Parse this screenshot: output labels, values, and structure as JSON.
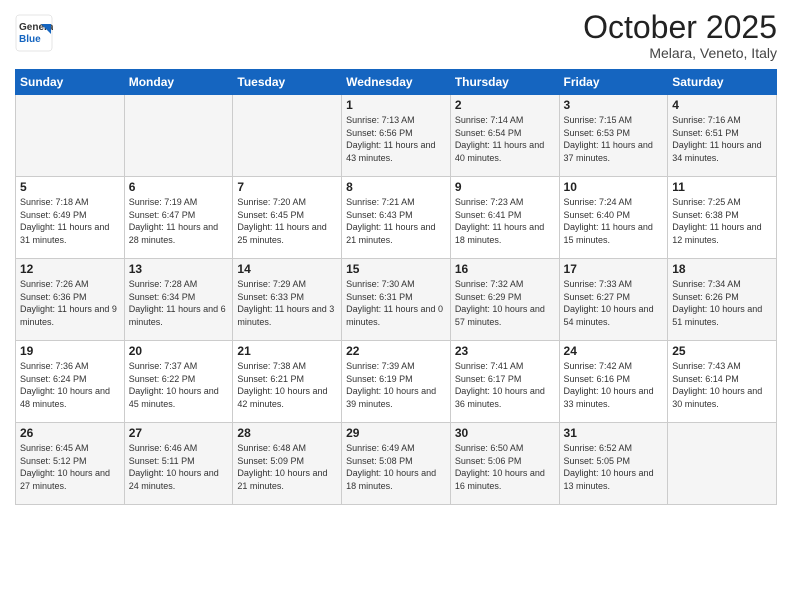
{
  "logo": {
    "general": "General",
    "blue": "Blue"
  },
  "header": {
    "month": "October 2025",
    "location": "Melara, Veneto, Italy"
  },
  "weekdays": [
    "Sunday",
    "Monday",
    "Tuesday",
    "Wednesday",
    "Thursday",
    "Friday",
    "Saturday"
  ],
  "weeks": [
    [
      {
        "day": "",
        "info": ""
      },
      {
        "day": "",
        "info": ""
      },
      {
        "day": "",
        "info": ""
      },
      {
        "day": "1",
        "info": "Sunrise: 7:13 AM\nSunset: 6:56 PM\nDaylight: 11 hours\nand 43 minutes."
      },
      {
        "day": "2",
        "info": "Sunrise: 7:14 AM\nSunset: 6:54 PM\nDaylight: 11 hours\nand 40 minutes."
      },
      {
        "day": "3",
        "info": "Sunrise: 7:15 AM\nSunset: 6:53 PM\nDaylight: 11 hours\nand 37 minutes."
      },
      {
        "day": "4",
        "info": "Sunrise: 7:16 AM\nSunset: 6:51 PM\nDaylight: 11 hours\nand 34 minutes."
      }
    ],
    [
      {
        "day": "5",
        "info": "Sunrise: 7:18 AM\nSunset: 6:49 PM\nDaylight: 11 hours\nand 31 minutes."
      },
      {
        "day": "6",
        "info": "Sunrise: 7:19 AM\nSunset: 6:47 PM\nDaylight: 11 hours\nand 28 minutes."
      },
      {
        "day": "7",
        "info": "Sunrise: 7:20 AM\nSunset: 6:45 PM\nDaylight: 11 hours\nand 25 minutes."
      },
      {
        "day": "8",
        "info": "Sunrise: 7:21 AM\nSunset: 6:43 PM\nDaylight: 11 hours\nand 21 minutes."
      },
      {
        "day": "9",
        "info": "Sunrise: 7:23 AM\nSunset: 6:41 PM\nDaylight: 11 hours\nand 18 minutes."
      },
      {
        "day": "10",
        "info": "Sunrise: 7:24 AM\nSunset: 6:40 PM\nDaylight: 11 hours\nand 15 minutes."
      },
      {
        "day": "11",
        "info": "Sunrise: 7:25 AM\nSunset: 6:38 PM\nDaylight: 11 hours\nand 12 minutes."
      }
    ],
    [
      {
        "day": "12",
        "info": "Sunrise: 7:26 AM\nSunset: 6:36 PM\nDaylight: 11 hours\nand 9 minutes."
      },
      {
        "day": "13",
        "info": "Sunrise: 7:28 AM\nSunset: 6:34 PM\nDaylight: 11 hours\nand 6 minutes."
      },
      {
        "day": "14",
        "info": "Sunrise: 7:29 AM\nSunset: 6:33 PM\nDaylight: 11 hours\nand 3 minutes."
      },
      {
        "day": "15",
        "info": "Sunrise: 7:30 AM\nSunset: 6:31 PM\nDaylight: 11 hours\nand 0 minutes."
      },
      {
        "day": "16",
        "info": "Sunrise: 7:32 AM\nSunset: 6:29 PM\nDaylight: 10 hours\nand 57 minutes."
      },
      {
        "day": "17",
        "info": "Sunrise: 7:33 AM\nSunset: 6:27 PM\nDaylight: 10 hours\nand 54 minutes."
      },
      {
        "day": "18",
        "info": "Sunrise: 7:34 AM\nSunset: 6:26 PM\nDaylight: 10 hours\nand 51 minutes."
      }
    ],
    [
      {
        "day": "19",
        "info": "Sunrise: 7:36 AM\nSunset: 6:24 PM\nDaylight: 10 hours\nand 48 minutes."
      },
      {
        "day": "20",
        "info": "Sunrise: 7:37 AM\nSunset: 6:22 PM\nDaylight: 10 hours\nand 45 minutes."
      },
      {
        "day": "21",
        "info": "Sunrise: 7:38 AM\nSunset: 6:21 PM\nDaylight: 10 hours\nand 42 minutes."
      },
      {
        "day": "22",
        "info": "Sunrise: 7:39 AM\nSunset: 6:19 PM\nDaylight: 10 hours\nand 39 minutes."
      },
      {
        "day": "23",
        "info": "Sunrise: 7:41 AM\nSunset: 6:17 PM\nDaylight: 10 hours\nand 36 minutes."
      },
      {
        "day": "24",
        "info": "Sunrise: 7:42 AM\nSunset: 6:16 PM\nDaylight: 10 hours\nand 33 minutes."
      },
      {
        "day": "25",
        "info": "Sunrise: 7:43 AM\nSunset: 6:14 PM\nDaylight: 10 hours\nand 30 minutes."
      }
    ],
    [
      {
        "day": "26",
        "info": "Sunrise: 6:45 AM\nSunset: 5:12 PM\nDaylight: 10 hours\nand 27 minutes."
      },
      {
        "day": "27",
        "info": "Sunrise: 6:46 AM\nSunset: 5:11 PM\nDaylight: 10 hours\nand 24 minutes."
      },
      {
        "day": "28",
        "info": "Sunrise: 6:48 AM\nSunset: 5:09 PM\nDaylight: 10 hours\nand 21 minutes."
      },
      {
        "day": "29",
        "info": "Sunrise: 6:49 AM\nSunset: 5:08 PM\nDaylight: 10 hours\nand 18 minutes."
      },
      {
        "day": "30",
        "info": "Sunrise: 6:50 AM\nSunset: 5:06 PM\nDaylight: 10 hours\nand 16 minutes."
      },
      {
        "day": "31",
        "info": "Sunrise: 6:52 AM\nSunset: 5:05 PM\nDaylight: 10 hours\nand 13 minutes."
      },
      {
        "day": "",
        "info": ""
      }
    ]
  ]
}
